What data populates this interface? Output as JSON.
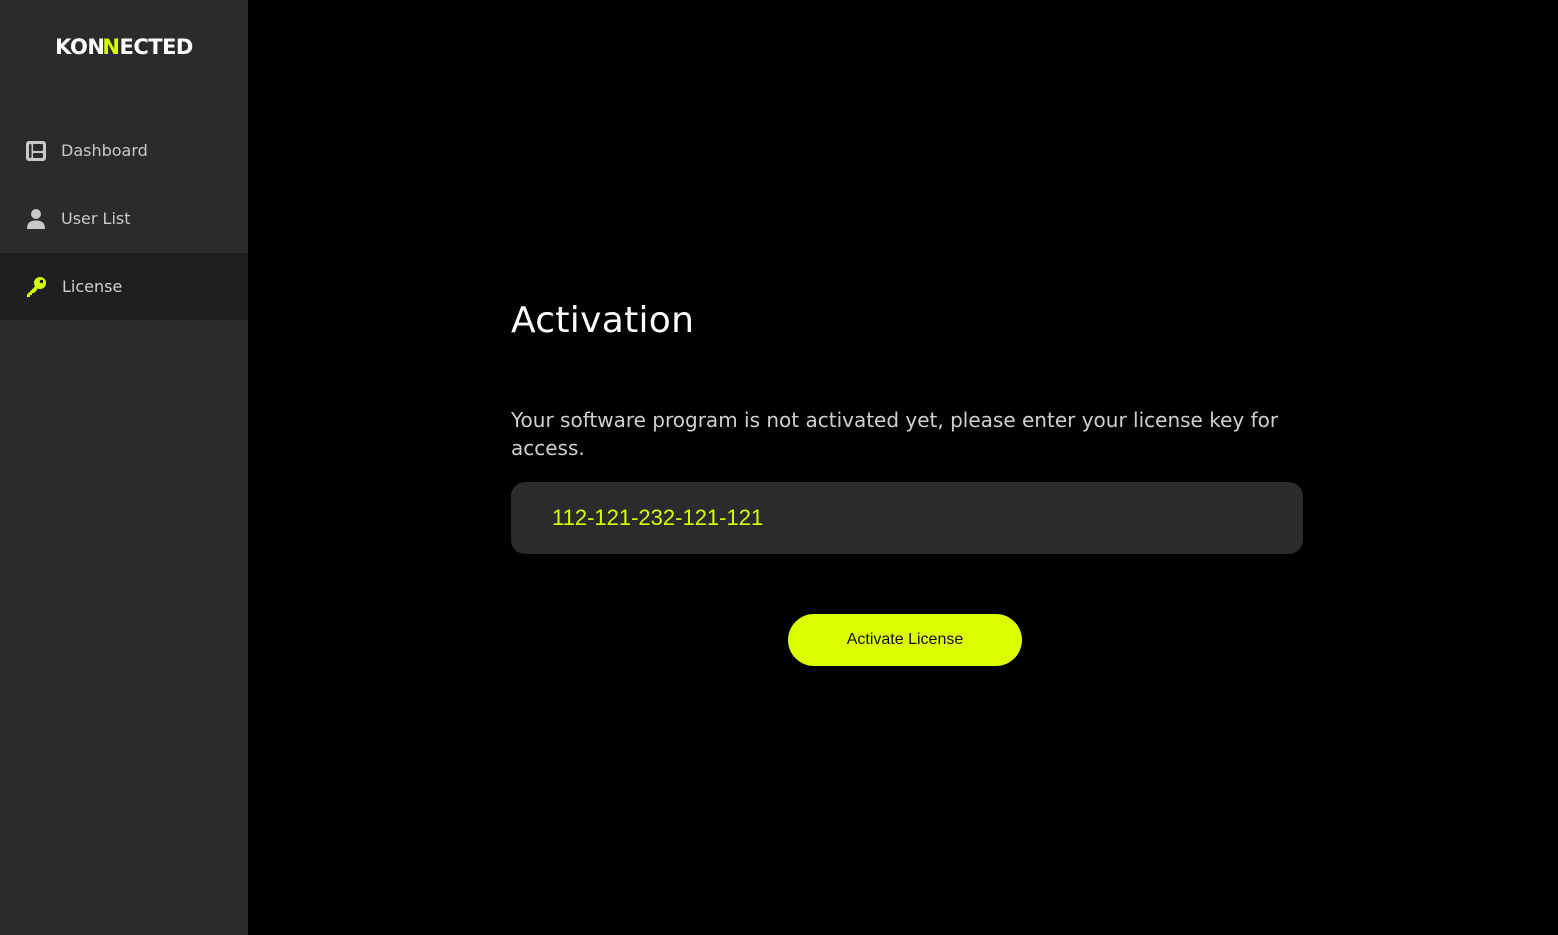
{
  "brand": {
    "logo_prefix": "KO",
    "logo_accent": "N",
    "logo_suffix": "ECTED",
    "accent_color": "#d7ff00"
  },
  "sidebar": {
    "items": [
      {
        "label": "Dashboard",
        "icon": "dashboard-icon",
        "active": false
      },
      {
        "label": "User List",
        "icon": "user-icon",
        "active": false
      },
      {
        "label": "License",
        "icon": "key-icon",
        "active": true
      }
    ]
  },
  "main": {
    "title": "Activation",
    "description": "Your software program is not activated yet, please enter your license key for access.",
    "license_input": {
      "value": "112-121-232-121-121",
      "placeholder": ""
    },
    "activate_button": "Activate License"
  },
  "colors": {
    "sidebar_bg": "#2a2b2d",
    "active_item_bg": "#1f1f21",
    "main_bg": "#000000",
    "button_bg": "#dbff00",
    "input_bg": "#2a2b2d"
  }
}
